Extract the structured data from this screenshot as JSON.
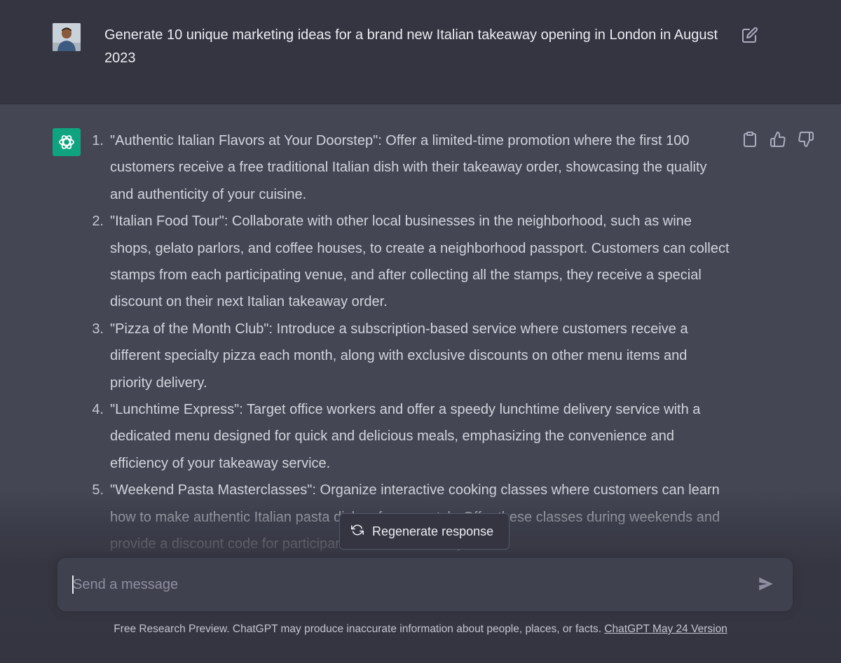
{
  "user_message": {
    "text": "Generate 10 unique marketing ideas for a brand new Italian takeaway opening in London in August 2023"
  },
  "assistant": {
    "items": [
      {
        "number": "1.",
        "text": "\"Authentic Italian Flavors at Your Doorstep\": Offer a limited-time promotion where the first 100 customers receive a free traditional Italian dish with their takeaway order, showcasing the quality and authenticity of your cuisine."
      },
      {
        "number": "2.",
        "text": "\"Italian Food Tour\": Collaborate with other local businesses in the neighborhood, such as wine shops, gelato parlors, and coffee houses, to create a neighborhood passport. Customers can collect stamps from each participating venue, and after collecting all the stamps, they receive a special discount on their next Italian takeaway order."
      },
      {
        "number": "3.",
        "text": "\"Pizza of the Month Club\": Introduce a subscription-based service where customers receive a different specialty pizza each month, along with exclusive discounts on other menu items and priority delivery."
      },
      {
        "number": "4.",
        "text": "\"Lunchtime Express\": Target office workers and offer a speedy lunchtime delivery service with a dedicated menu designed for quick and delicious meals, emphasizing the convenience and efficiency of your takeaway service."
      },
      {
        "number": "5.",
        "text": "\"Weekend Pasta Masterclasses\": Organize interactive cooking classes where customers can learn how to make authentic Italian pasta dishes from scratch. Offer these classes during weekends and provide a discount code for participants to use when they order"
      }
    ]
  },
  "regenerate": {
    "label": "Regenerate response"
  },
  "composer": {
    "placeholder": "Send a message"
  },
  "footer": {
    "text": "Free Research Preview. ChatGPT may produce inaccurate information about people, places, or facts. ",
    "link": "ChatGPT May 24 Version"
  },
  "icons": {
    "edit": "edit-icon",
    "copy": "clipboard-icon",
    "thumbs_up": "thumbs-up-icon",
    "thumbs_down": "thumbs-down-icon",
    "regenerate": "refresh-icon",
    "send": "send-icon",
    "brand_color": "#10a37f"
  }
}
